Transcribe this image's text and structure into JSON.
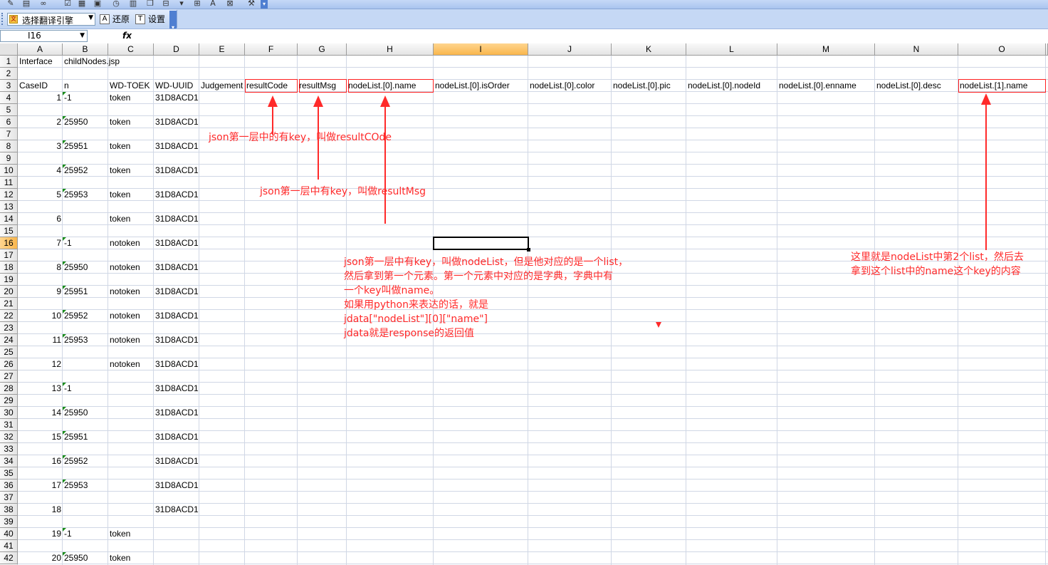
{
  "translate_toolbar": {
    "engine_select": "选择翻译引擎",
    "restore_label": "还原",
    "settings_label": "设置"
  },
  "formula_bar": {
    "name_box": "I16",
    "fx_label": "fx"
  },
  "columns": [
    "A",
    "B",
    "C",
    "D",
    "E",
    "F",
    "G",
    "H",
    "I",
    "J",
    "K",
    "L",
    "M",
    "N",
    "O"
  ],
  "rows": [
    "1",
    "2",
    "3",
    "4",
    "5",
    "6",
    "7",
    "8",
    "9",
    "10",
    "11",
    "12",
    "13",
    "14",
    "15",
    "16",
    "17",
    "18",
    "19",
    "20",
    "21",
    "22",
    "23",
    "24",
    "25",
    "26",
    "27",
    "28",
    "29",
    "30",
    "31",
    "32",
    "33",
    "34",
    "35",
    "36",
    "37",
    "38",
    "39",
    "40",
    "41",
    "42"
  ],
  "sheet": {
    "interface_label": "Interface",
    "interface_value": "childNodes.jsp",
    "headers": [
      "CaseID",
      "n",
      "WD-TOEK",
      "WD-UUID",
      "Judgement",
      "resultCode",
      "resultMsg",
      "nodeList.[0].name",
      "nodeList.[0].isOrder",
      "nodeList.[0].color",
      "nodeList.[0].pic",
      "nodeList.[0].nodeId",
      "nodeList.[0].enname",
      "nodeList.[0].desc",
      "nodeList.[1].name"
    ],
    "cases": [
      {
        "id": "1",
        "n": "-1",
        "token": "token",
        "uuid": "31D8ACD1"
      },
      {
        "id": "2",
        "n": "25950",
        "token": "token",
        "uuid": "31D8ACD1"
      },
      {
        "id": "3",
        "n": "25951",
        "token": "token",
        "uuid": "31D8ACD1"
      },
      {
        "id": "4",
        "n": "25952",
        "token": "token",
        "uuid": "31D8ACD1"
      },
      {
        "id": "5",
        "n": "25953",
        "token": "token",
        "uuid": "31D8ACD1"
      },
      {
        "id": "6",
        "n": "",
        "token": "token",
        "uuid": "31D8ACD1"
      },
      {
        "id": "7",
        "n": "-1",
        "token": "notoken",
        "uuid": "31D8ACD1"
      },
      {
        "id": "8",
        "n": "25950",
        "token": "notoken",
        "uuid": "31D8ACD1"
      },
      {
        "id": "9",
        "n": "25951",
        "token": "notoken",
        "uuid": "31D8ACD1"
      },
      {
        "id": "10",
        "n": "25952",
        "token": "notoken",
        "uuid": "31D8ACD1"
      },
      {
        "id": "11",
        "n": "25953",
        "token": "notoken",
        "uuid": "31D8ACD1"
      },
      {
        "id": "12",
        "n": "",
        "token": "notoken",
        "uuid": "31D8ACD1"
      },
      {
        "id": "13",
        "n": "-1",
        "token": "",
        "uuid": "31D8ACD1"
      },
      {
        "id": "14",
        "n": "25950",
        "token": "",
        "uuid": "31D8ACD1"
      },
      {
        "id": "15",
        "n": "25951",
        "token": "",
        "uuid": "31D8ACD1"
      },
      {
        "id": "16",
        "n": "25952",
        "token": "",
        "uuid": "31D8ACD1"
      },
      {
        "id": "17",
        "n": "25953",
        "token": "",
        "uuid": "31D8ACD1"
      },
      {
        "id": "18",
        "n": "",
        "token": "",
        "uuid": "31D8ACD1"
      },
      {
        "id": "19",
        "n": "-1",
        "token": "token",
        "uuid": ""
      },
      {
        "id": "20",
        "n": "25950",
        "token": "token",
        "uuid": ""
      }
    ]
  },
  "annotations": {
    "result_code_note": "json第一层中的有key，叫做resultCOde",
    "result_msg_note": "json第一层中有key，叫做resultMsg",
    "node_list_note": [
      "json第一层中有key，叫做nodeList，但是他对应的是一个list，",
      "然后拿到第一个元素。第一个元素中对应的是字典，字典中有",
      "一个key叫做name。",
      "如果用python来表达的话，就是",
      "jdata[\"nodeList\"][0][\"name\"]",
      "jdata就是response的返回值"
    ],
    "second_list_note": [
      "这里就是nodeList中第2个list，然后去",
      "拿到这个list中的name这个key的内容"
    ]
  },
  "colors": {
    "annotation": "#ff2a2a",
    "grid_line": "#d0d7e5",
    "active_header": "#f9b64c"
  }
}
